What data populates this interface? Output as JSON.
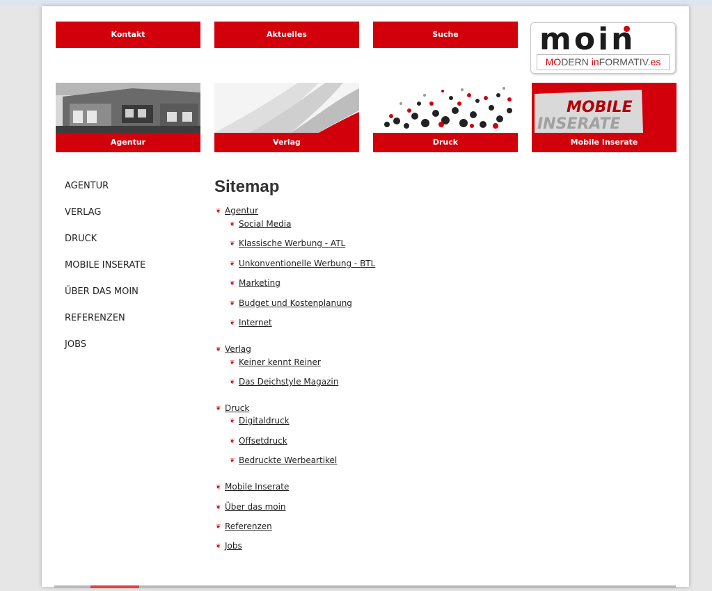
{
  "topnav": [
    "Kontakt",
    "Aktuelles",
    "Suche"
  ],
  "logo": {
    "word": "moin",
    "sub_a": "MO",
    "sub_b": "DERN ",
    "sub_c": "in",
    "sub_d": "FORMATIV.",
    "sub_e": "es"
  },
  "tiles": [
    {
      "label": "Agentur",
      "image": "building-photo"
    },
    {
      "label": "Verlag",
      "image": "book-pages-photo"
    },
    {
      "label": "Druck",
      "image": "dots-pattern"
    },
    {
      "label": "Mobile Inserate",
      "image": "mobile-inserate-graphic",
      "graphic_line1": "MOBILE",
      "graphic_line2": "INSERATE"
    }
  ],
  "sidebar": [
    "AGENTUR",
    "VERLAG",
    "DRUCK",
    "MOBILE INSERATE",
    "ÜBER DAS MOIN",
    "REFERENZEN",
    "JOBS"
  ],
  "sitemap": {
    "title": "Sitemap",
    "groups": [
      {
        "label": "Agentur",
        "children": [
          "Social Media",
          "Klassische Werbung - ATL",
          "Unkonventionelle Werbung - BTL",
          "Marketing",
          "Budget und Kostenplanung",
          "Internet"
        ]
      },
      {
        "label": "Verlag",
        "children": [
          "Keiner kennt Reiner",
          "Das Deichstyle Magazin"
        ]
      },
      {
        "label": "Druck",
        "children": [
          "Digitaldruck",
          "Offsetdruck",
          "Bedruckte Werbeartikel"
        ]
      },
      {
        "label": "Mobile Inserate",
        "children": []
      },
      {
        "label": "Über das moin",
        "children": []
      },
      {
        "label": "Referenzen",
        "children": []
      },
      {
        "label": "Jobs",
        "children": []
      }
    ]
  },
  "colors": {
    "brand_red": "#d2000a",
    "bullet_red": "#c41a1a"
  }
}
